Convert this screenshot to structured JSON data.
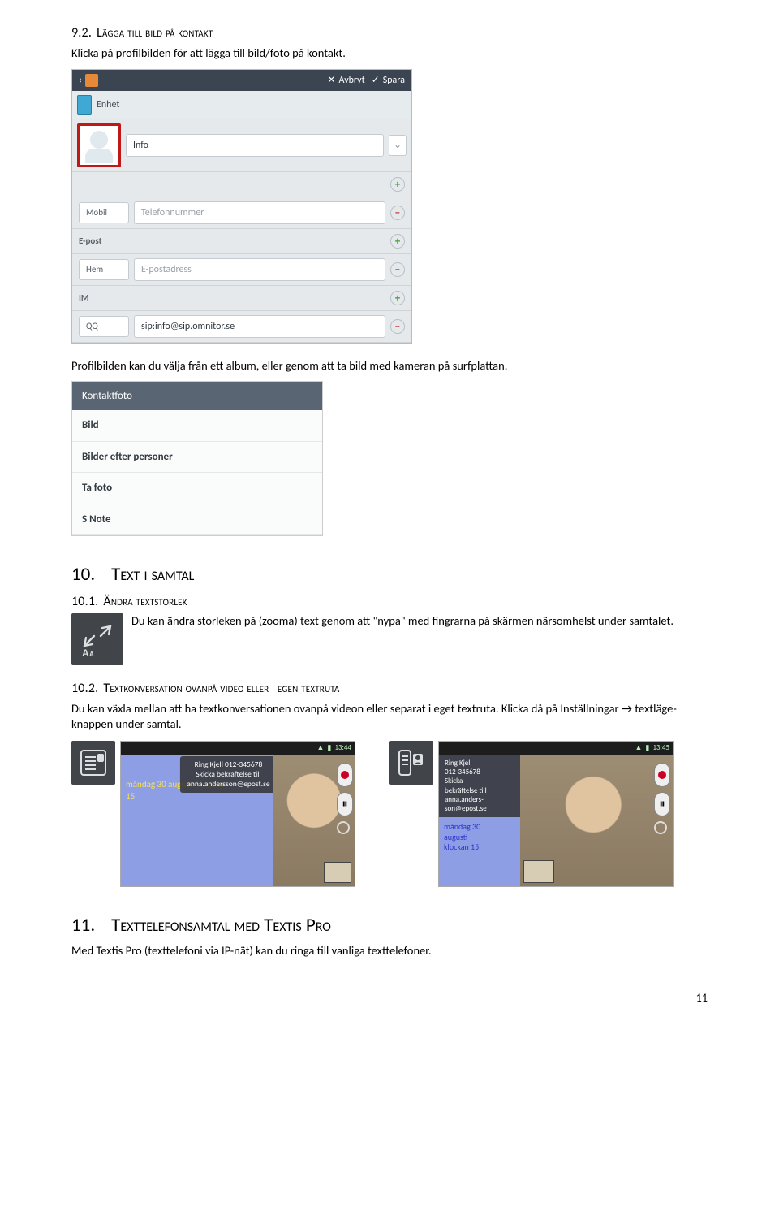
{
  "heading_9_2": {
    "num": "9.2.",
    "title": "Lägga till bild på kontakt"
  },
  "text_9_2": "Klicka på profilbilden för att lägga till bild/foto på kontakt.",
  "contact_editor": {
    "cancel": "Avbryt",
    "save": "Spara",
    "device_label": "Enhet",
    "name_value": "Info",
    "phone_section": "",
    "phone_type": "Mobil",
    "phone_placeholder": "Telefonnummer",
    "email_section": "E-post",
    "email_type": "Hem",
    "email_placeholder": "E-postadress",
    "im_section": "IM",
    "im_type": "QQ",
    "im_value": "sip:info@sip.omnitor.se"
  },
  "text_9_2b": "Profilbilden kan du välja från ett album, eller genom att ta bild med kameran på surfplattan.",
  "photo_picker": {
    "header": "Kontaktfoto",
    "options": [
      "Bild",
      "Bilder efter personer",
      "Ta foto",
      "S Note"
    ]
  },
  "heading_10": {
    "num": "10.",
    "title": "Text i samtal"
  },
  "heading_10_1": {
    "num": "10.1.",
    "title": "Ändra textstorlek"
  },
  "text_10_1": "Du kan ändra storleken på (zooma) text genom att \"nypa\" med fingrarna på skärmen närsomhelst under samtalet.",
  "heading_10_2": {
    "num": "10.2.",
    "title": "Textkonversation ovanpå video eller i egen textruta"
  },
  "text_10_2": "Du kan växla mellan att ha textkonversationen ovanpå videon eller separat i eget textruta. Klicka då på Inställningar → textläge-knappen under samtal.",
  "call1": {
    "time": "13:44",
    "tooltip_line1": "Ring Kjell 012-345678",
    "tooltip_line2": "Skicka bekräftelse till",
    "tooltip_line3": "anna.andersson@epost.se",
    "msg_line1": "måndag 30 augusti klockan",
    "msg_line2": "15"
  },
  "call2": {
    "time": "13:45",
    "tooltip_line1": "Ring Kjell",
    "tooltip_line2": "012-345678",
    "tooltip_line3": "Skicka",
    "tooltip_line4": "bekräftelse till",
    "tooltip_line5": "anna.anders-",
    "tooltip_line6": "son@epost.se",
    "msg_line1": "måndag 30",
    "msg_line2": "augusti",
    "msg_line3": "klockan 15"
  },
  "heading_11": {
    "num": "11.",
    "title": "Texttelefonsamtal med Textis Pro"
  },
  "text_11": "Med Textis Pro (texttelefoni via IP-nät) kan du ringa till vanliga texttelefoner.",
  "page_number": "11"
}
